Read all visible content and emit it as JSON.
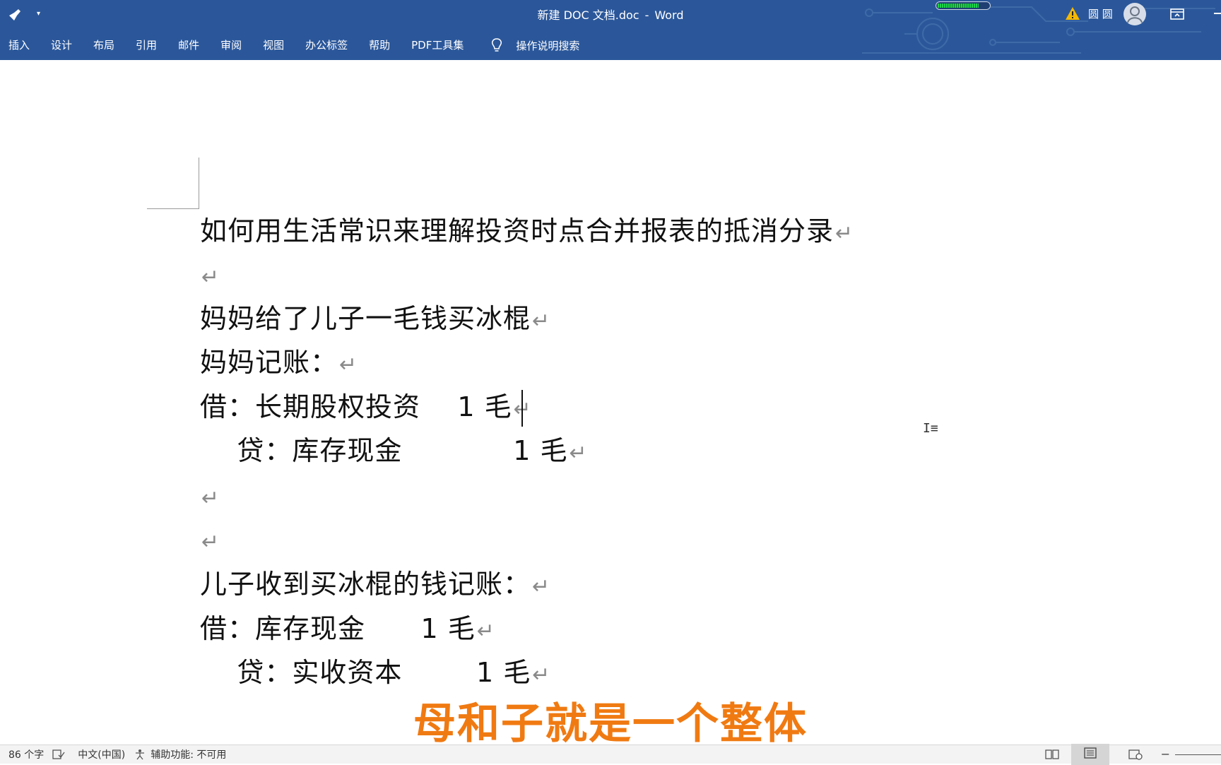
{
  "window": {
    "doc_name": "新建 DOC 文档.doc",
    "separator": "-",
    "app_name": "Word",
    "user_name": "圆 圆",
    "download_progress": 0.8
  },
  "ribbon": {
    "tabs": [
      "插入",
      "设计",
      "布局",
      "引用",
      "邮件",
      "审阅",
      "视图",
      "办公标签",
      "帮助",
      "PDF工具集"
    ],
    "tell_me": "操作说明搜索"
  },
  "document": {
    "lines": [
      "如何用生活常识来理解投资时点合并报表的抵消分录",
      "",
      "妈妈给了儿子一毛钱买冰棍",
      "妈妈记账：",
      "借：长期股权投资    1 毛",
      "    贷：库存现金            1 毛",
      "",
      "",
      "儿子收到买冰棍的钱记账：",
      "借：库存现金      1 毛",
      "    贷：实收资本        1 毛"
    ],
    "paragraph_mark": "↵"
  },
  "video_subtitle": "母和子就是一个整体",
  "status": {
    "word_count": "86 个字",
    "language": "中文(中国)",
    "accessibility": "辅助功能: 不可用"
  },
  "colors": {
    "ribbon_blue": "#2b579a",
    "subtitle_orange": "#f07a12"
  },
  "icons": [
    "brush-icon",
    "customize-icon",
    "warning-icon",
    "avatar-icon",
    "ribbon-display-icon",
    "lightbulb-icon",
    "proofing-icon",
    "accessibility-icon",
    "read-mode-icon",
    "print-layout-icon",
    "web-layout-icon"
  ]
}
